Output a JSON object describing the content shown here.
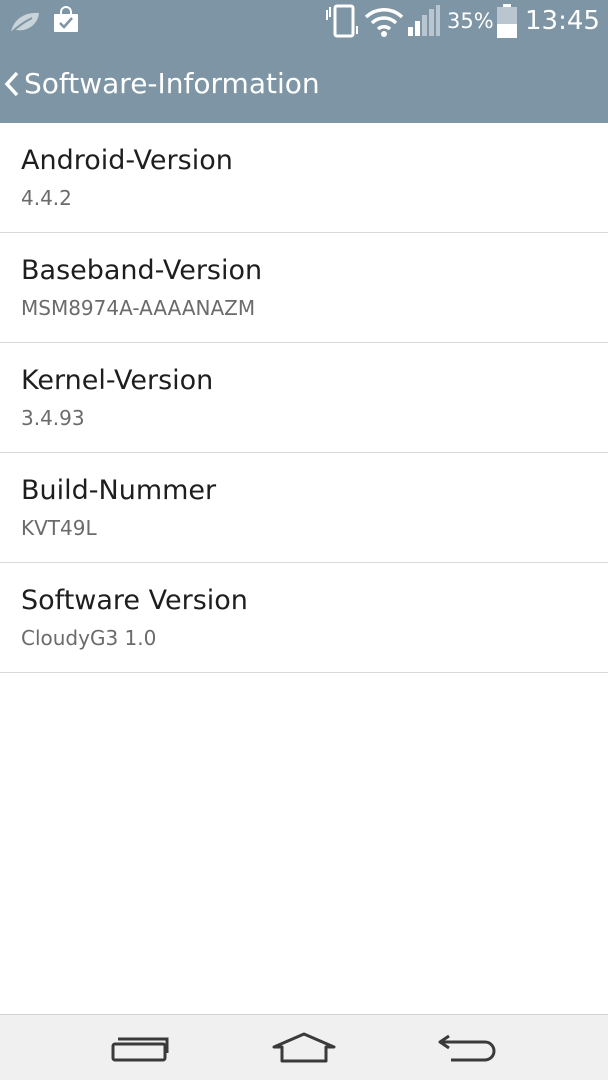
{
  "status_bar": {
    "battery_percent": "35%",
    "time": "13:45",
    "icons": [
      "leaf-icon",
      "shopping-bag-check-icon",
      "vibrate-icon",
      "wifi-icon",
      "signal-icon",
      "battery-icon"
    ]
  },
  "header": {
    "title": "Software-Information",
    "back_icon": "chevron-left-icon",
    "background_color": "#7d95a4"
  },
  "items": [
    {
      "title": "Android-Version",
      "value": "4.4.2"
    },
    {
      "title": "Baseband-Version",
      "value": "MSM8974A-AAAANAZM"
    },
    {
      "title": "Kernel-Version",
      "value": "3.4.93"
    },
    {
      "title": "Build-Nummer",
      "value": "KVT49L"
    },
    {
      "title": "Software Version",
      "value": "CloudyG3 1.0"
    }
  ],
  "nav_bar": {
    "icons": [
      "recent-apps-icon",
      "home-icon",
      "back-icon"
    ]
  }
}
